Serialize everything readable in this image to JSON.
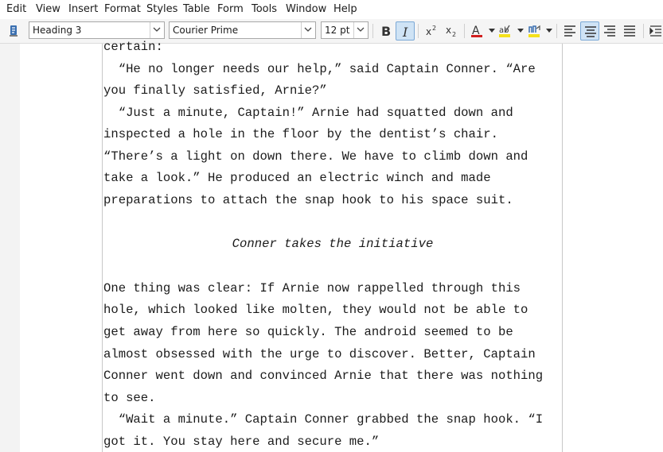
{
  "menu": [
    "Edit",
    "View",
    "Insert",
    "Format",
    "Styles",
    "Table",
    "Form",
    "Tools",
    "Window",
    "Help"
  ],
  "toolbar": {
    "paragraph_style": "Heading 3",
    "font_name": "Courier Prime",
    "font_size": "12 pt",
    "font_color": "#d11f1f",
    "highlight_color": "#f5e11a",
    "char_bg_color": "#f5e11a"
  },
  "document": {
    "lines_before": [
      "certain:",
      "  “He no longer needs our help,” said Captain Conner. “Are",
      "you finally satisfied, Arnie?”",
      "  “Just a minute, Captain!” Arnie had squatted down and",
      "inspected a hole in the floor by the dentist’s chair.",
      "“There’s a light on down there. We have to climb down and",
      "take a look.” He produced an electric winch and made",
      "preparations to attach the snap hook to his space suit."
    ],
    "heading": "Conner takes the initiative",
    "lines_after": [
      "One thing was clear: If Arnie now rappelled through this",
      "hole, which looked like molten, they would not be able to",
      "get away from here so quickly. The android seemed to be",
      "almost obsessed with the urge to discover. Better, Captain",
      "Conner went down and convinced Arnie that there was nothing",
      "to see.",
      "  “Wait a minute.” Captain Conner grabbed the snap hook. “I",
      "got it. You stay here and secure me.”"
    ]
  }
}
